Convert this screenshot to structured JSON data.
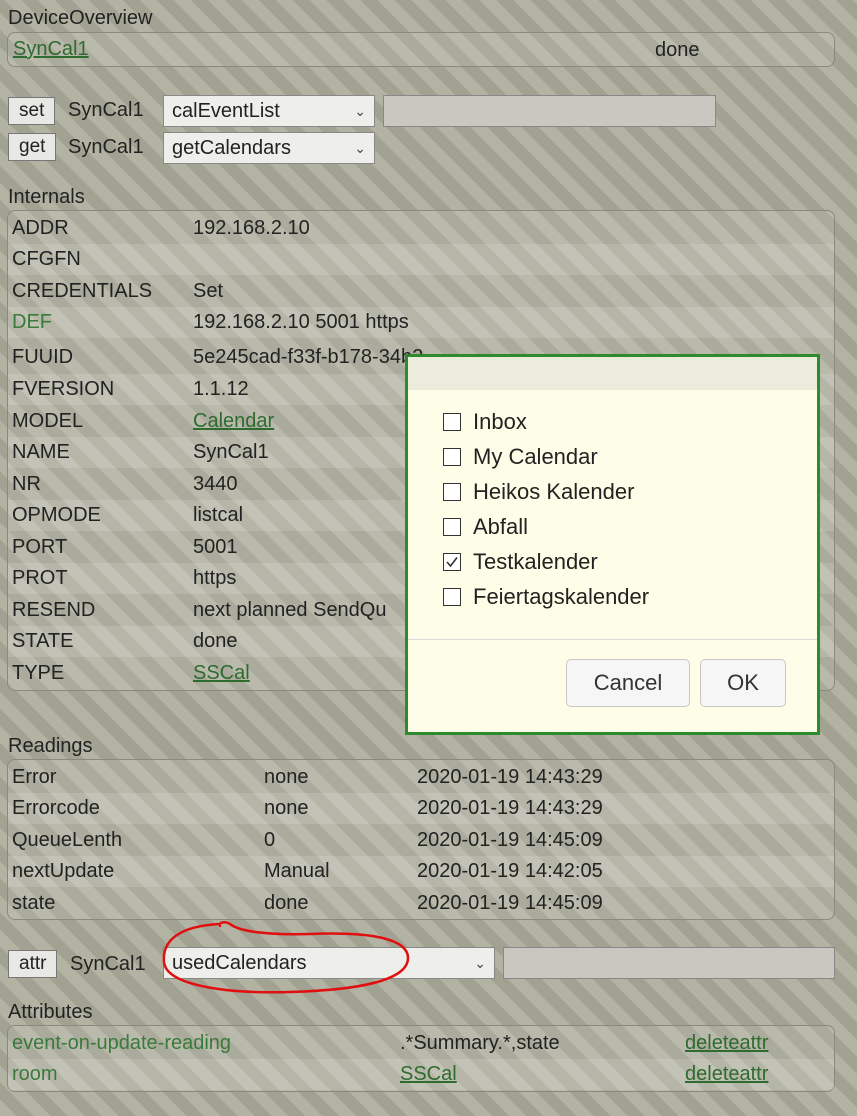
{
  "overview": {
    "title": "DeviceOverview",
    "device_link": "SynCal1",
    "status": "done"
  },
  "set_row": {
    "button": "set",
    "device": "SynCal1",
    "select_value": "calEventList",
    "input_value": ""
  },
  "get_row": {
    "button": "get",
    "device": "SynCal1",
    "select_value": "getCalendars"
  },
  "internals": {
    "title": "Internals",
    "rows": [
      {
        "key": "ADDR",
        "value": "192.168.2.10"
      },
      {
        "key": "CFGFN",
        "value": ""
      },
      {
        "key": "CREDENTIALS",
        "value": "Set"
      },
      {
        "key": "DEF",
        "value": "192.168.2.10 5001 https"
      },
      {
        "key": "FUUID",
        "value": "5e245cad-f33f-b178-34b2"
      },
      {
        "key": "FVERSION",
        "value": "1.1.12"
      },
      {
        "key": "MODEL",
        "value": "Calendar"
      },
      {
        "key": "NAME",
        "value": "SynCal1"
      },
      {
        "key": "NR",
        "value": "3440"
      },
      {
        "key": "OPMODE",
        "value": "listcal"
      },
      {
        "key": "PORT",
        "value": "5001"
      },
      {
        "key": "PROT",
        "value": "https"
      },
      {
        "key": "RESEND",
        "value": "next planned SendQu"
      },
      {
        "key": "STATE",
        "value": "done"
      },
      {
        "key": "TYPE",
        "value": "SSCal"
      }
    ]
  },
  "readings": {
    "title": "Readings",
    "rows": [
      {
        "name": "Error",
        "value": "none",
        "time": "2020-01-19 14:43:29"
      },
      {
        "name": "Errorcode",
        "value": "none",
        "time": "2020-01-19 14:43:29"
      },
      {
        "name": "QueueLenth",
        "value": "0",
        "time": "2020-01-19 14:45:09"
      },
      {
        "name": "nextUpdate",
        "value": "Manual",
        "time": "2020-01-19 14:42:05"
      },
      {
        "name": "state",
        "value": "done",
        "time": "2020-01-19 14:45:09"
      }
    ]
  },
  "attr_row": {
    "button": "attr",
    "device": "SynCal1",
    "select_value": "usedCalendars",
    "input_value": ""
  },
  "attributes": {
    "title": "Attributes",
    "rows": [
      {
        "name": "event-on-update-reading",
        "value": ".*Summary.*,state",
        "action": "deleteattr"
      },
      {
        "name": "room",
        "value": "SSCal",
        "action": "deleteattr"
      }
    ]
  },
  "dialog": {
    "options": [
      {
        "label": "Inbox",
        "checked": false
      },
      {
        "label": "My Calendar",
        "checked": false
      },
      {
        "label": "Heikos Kalender",
        "checked": false
      },
      {
        "label": "Abfall",
        "checked": false
      },
      {
        "label": "Testkalender",
        "checked": true
      },
      {
        "label": "Feiertagskalender",
        "checked": false
      }
    ],
    "cancel_label": "Cancel",
    "ok_label": "OK"
  },
  "colors": {
    "link": "#2e6b2e",
    "dialog_border": "#2d8a2d",
    "annotation": "#e01010",
    "dialog_bg": "#fefee8"
  }
}
